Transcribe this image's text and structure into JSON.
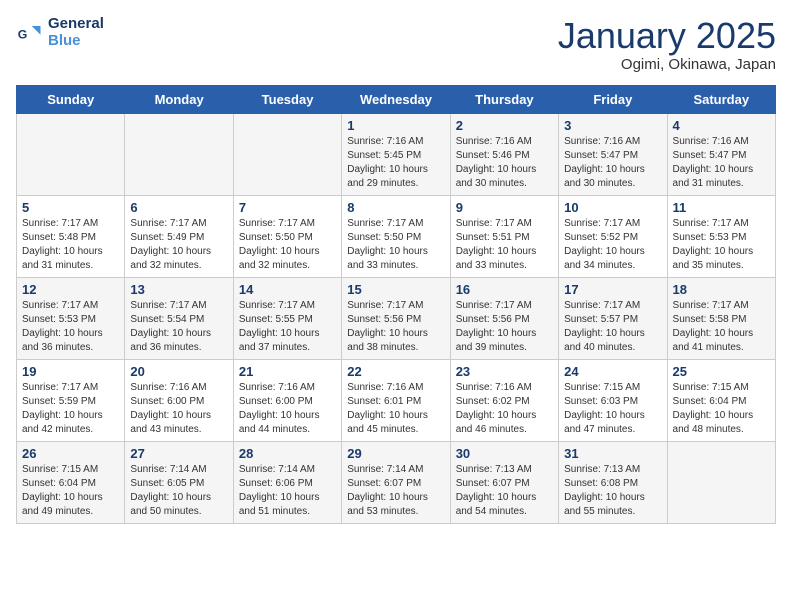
{
  "header": {
    "logo_line1": "General",
    "logo_line2": "Blue",
    "title": "January 2025",
    "subtitle": "Ogimi, Okinawa, Japan"
  },
  "weekdays": [
    "Sunday",
    "Monday",
    "Tuesday",
    "Wednesday",
    "Thursday",
    "Friday",
    "Saturday"
  ],
  "weeks": [
    [
      {
        "day": "",
        "info": ""
      },
      {
        "day": "",
        "info": ""
      },
      {
        "day": "",
        "info": ""
      },
      {
        "day": "1",
        "info": "Sunrise: 7:16 AM\nSunset: 5:45 PM\nDaylight: 10 hours and 29 minutes."
      },
      {
        "day": "2",
        "info": "Sunrise: 7:16 AM\nSunset: 5:46 PM\nDaylight: 10 hours and 30 minutes."
      },
      {
        "day": "3",
        "info": "Sunrise: 7:16 AM\nSunset: 5:47 PM\nDaylight: 10 hours and 30 minutes."
      },
      {
        "day": "4",
        "info": "Sunrise: 7:16 AM\nSunset: 5:47 PM\nDaylight: 10 hours and 31 minutes."
      }
    ],
    [
      {
        "day": "5",
        "info": "Sunrise: 7:17 AM\nSunset: 5:48 PM\nDaylight: 10 hours and 31 minutes."
      },
      {
        "day": "6",
        "info": "Sunrise: 7:17 AM\nSunset: 5:49 PM\nDaylight: 10 hours and 32 minutes."
      },
      {
        "day": "7",
        "info": "Sunrise: 7:17 AM\nSunset: 5:50 PM\nDaylight: 10 hours and 32 minutes."
      },
      {
        "day": "8",
        "info": "Sunrise: 7:17 AM\nSunset: 5:50 PM\nDaylight: 10 hours and 33 minutes."
      },
      {
        "day": "9",
        "info": "Sunrise: 7:17 AM\nSunset: 5:51 PM\nDaylight: 10 hours and 33 minutes."
      },
      {
        "day": "10",
        "info": "Sunrise: 7:17 AM\nSunset: 5:52 PM\nDaylight: 10 hours and 34 minutes."
      },
      {
        "day": "11",
        "info": "Sunrise: 7:17 AM\nSunset: 5:53 PM\nDaylight: 10 hours and 35 minutes."
      }
    ],
    [
      {
        "day": "12",
        "info": "Sunrise: 7:17 AM\nSunset: 5:53 PM\nDaylight: 10 hours and 36 minutes."
      },
      {
        "day": "13",
        "info": "Sunrise: 7:17 AM\nSunset: 5:54 PM\nDaylight: 10 hours and 36 minutes."
      },
      {
        "day": "14",
        "info": "Sunrise: 7:17 AM\nSunset: 5:55 PM\nDaylight: 10 hours and 37 minutes."
      },
      {
        "day": "15",
        "info": "Sunrise: 7:17 AM\nSunset: 5:56 PM\nDaylight: 10 hours and 38 minutes."
      },
      {
        "day": "16",
        "info": "Sunrise: 7:17 AM\nSunset: 5:56 PM\nDaylight: 10 hours and 39 minutes."
      },
      {
        "day": "17",
        "info": "Sunrise: 7:17 AM\nSunset: 5:57 PM\nDaylight: 10 hours and 40 minutes."
      },
      {
        "day": "18",
        "info": "Sunrise: 7:17 AM\nSunset: 5:58 PM\nDaylight: 10 hours and 41 minutes."
      }
    ],
    [
      {
        "day": "19",
        "info": "Sunrise: 7:17 AM\nSunset: 5:59 PM\nDaylight: 10 hours and 42 minutes."
      },
      {
        "day": "20",
        "info": "Sunrise: 7:16 AM\nSunset: 6:00 PM\nDaylight: 10 hours and 43 minutes."
      },
      {
        "day": "21",
        "info": "Sunrise: 7:16 AM\nSunset: 6:00 PM\nDaylight: 10 hours and 44 minutes."
      },
      {
        "day": "22",
        "info": "Sunrise: 7:16 AM\nSunset: 6:01 PM\nDaylight: 10 hours and 45 minutes."
      },
      {
        "day": "23",
        "info": "Sunrise: 7:16 AM\nSunset: 6:02 PM\nDaylight: 10 hours and 46 minutes."
      },
      {
        "day": "24",
        "info": "Sunrise: 7:15 AM\nSunset: 6:03 PM\nDaylight: 10 hours and 47 minutes."
      },
      {
        "day": "25",
        "info": "Sunrise: 7:15 AM\nSunset: 6:04 PM\nDaylight: 10 hours and 48 minutes."
      }
    ],
    [
      {
        "day": "26",
        "info": "Sunrise: 7:15 AM\nSunset: 6:04 PM\nDaylight: 10 hours and 49 minutes."
      },
      {
        "day": "27",
        "info": "Sunrise: 7:14 AM\nSunset: 6:05 PM\nDaylight: 10 hours and 50 minutes."
      },
      {
        "day": "28",
        "info": "Sunrise: 7:14 AM\nSunset: 6:06 PM\nDaylight: 10 hours and 51 minutes."
      },
      {
        "day": "29",
        "info": "Sunrise: 7:14 AM\nSunset: 6:07 PM\nDaylight: 10 hours and 53 minutes."
      },
      {
        "day": "30",
        "info": "Sunrise: 7:13 AM\nSunset: 6:07 PM\nDaylight: 10 hours and 54 minutes."
      },
      {
        "day": "31",
        "info": "Sunrise: 7:13 AM\nSunset: 6:08 PM\nDaylight: 10 hours and 55 minutes."
      },
      {
        "day": "",
        "info": ""
      }
    ]
  ]
}
